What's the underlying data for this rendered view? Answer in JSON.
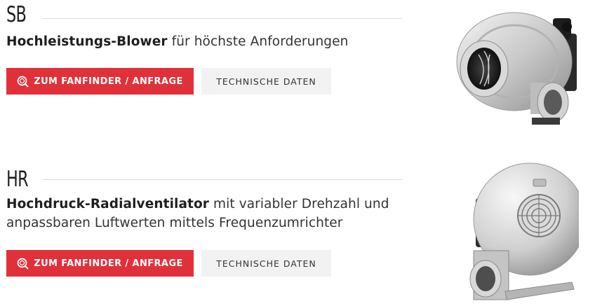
{
  "products": [
    {
      "code": "SB",
      "title_bold": "Hochleistungs-Blower",
      "title_rest": " für höchste Anforderungen",
      "fanfinder_label": "ZUM FANFINDER / ANFRAGE",
      "techdata_label": "TECHNISCHE DATEN",
      "image_name": "sb-blower-image"
    },
    {
      "code": "HR",
      "title_bold": "Hochdruck-Radialventilator",
      "title_rest": " mit variabler Drehzahl und anpassbaren Luftwerten mittels Frequenzumrichter",
      "fanfinder_label": "ZUM FANFINDER / ANFRAGE",
      "techdata_label": "TECHNISCHE DATEN",
      "image_name": "hr-fan-image"
    }
  ],
  "colors": {
    "accent": "#e0313b",
    "secondary_button": "#f2f2f2",
    "rule": "#dcdcdc"
  },
  "icons": {
    "fanfinder": "search-icon"
  }
}
